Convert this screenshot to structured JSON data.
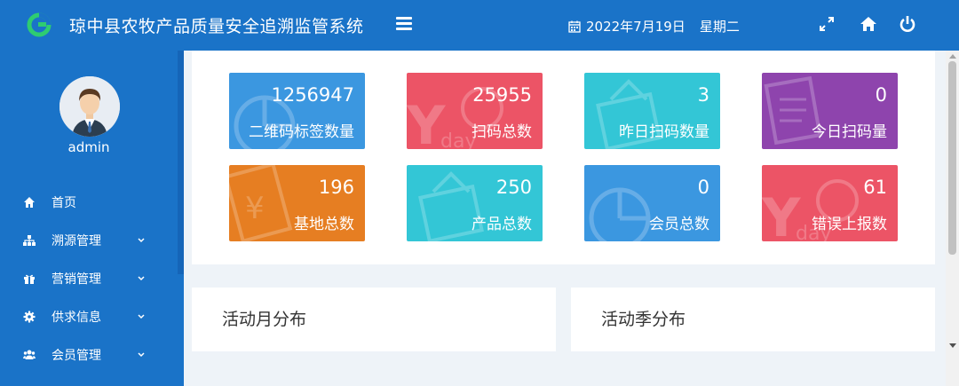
{
  "header": {
    "title": "琼中县农牧产品质量安全追溯监管系统",
    "date": "2022年7月19日",
    "weekday": "星期二"
  },
  "sidebar": {
    "username": "admin",
    "items": [
      {
        "label": "首页",
        "icon": "home-icon"
      },
      {
        "label": "溯源管理",
        "icon": "sitemap-icon"
      },
      {
        "label": "营销管理",
        "icon": "gift-icon"
      },
      {
        "label": "供求信息",
        "icon": "gear-icon"
      },
      {
        "label": "会员管理",
        "icon": "users-icon"
      }
    ]
  },
  "stats": [
    {
      "value": "1256947",
      "label": "二维码标签数量",
      "color": "#3b97e0"
    },
    {
      "value": "25955",
      "label": "扫码总数",
      "color": "#ec5466"
    },
    {
      "value": "3",
      "label": "昨日扫码数量",
      "color": "#33c6d6"
    },
    {
      "value": "0",
      "label": "今日扫码量",
      "color": "#8e44ad"
    },
    {
      "value": "196",
      "label": "基地总数",
      "color": "#e67e22"
    },
    {
      "value": "250",
      "label": "产品总数",
      "color": "#33c6d6"
    },
    {
      "value": "0",
      "label": "会员总数",
      "color": "#3b97e0"
    },
    {
      "value": "61",
      "label": "错误上报数",
      "color": "#ec5466"
    }
  ],
  "panels": {
    "monthly_title": "活动月分布",
    "quarterly_title": "活动季分布"
  }
}
